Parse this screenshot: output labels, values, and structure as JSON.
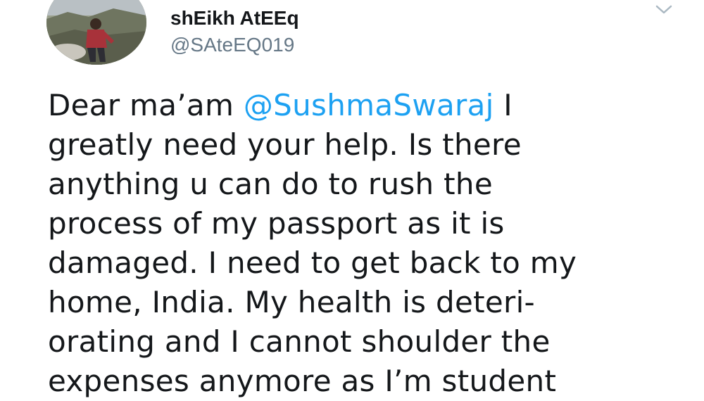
{
  "user": {
    "display_name": "shEikh AtEEq",
    "handle": "@SAteEQ019"
  },
  "icons": {
    "menu": "chevron-down-icon",
    "avatar": "avatar-photo"
  },
  "tweet": {
    "lines": [
      {
        "before": "Dear ma’am ",
        "mention": "@SushmaSwaraj",
        "after": " I"
      },
      {
        "text": "greatly need your help. Is there"
      },
      {
        "text": "anything u can do to rush the"
      },
      {
        "text": "process of my passport as it is"
      },
      {
        "text": "damaged. I need to get back to my"
      },
      {
        "text": "home, India. My health is deteri-"
      },
      {
        "text": "orating and I cannot shoulder the"
      },
      {
        "text": "expenses anymore as I’m student"
      }
    ]
  },
  "colors": {
    "mention": "#1da1f2",
    "handle": "#657786",
    "text": "#14171a",
    "chevron": "#aab8c2"
  }
}
